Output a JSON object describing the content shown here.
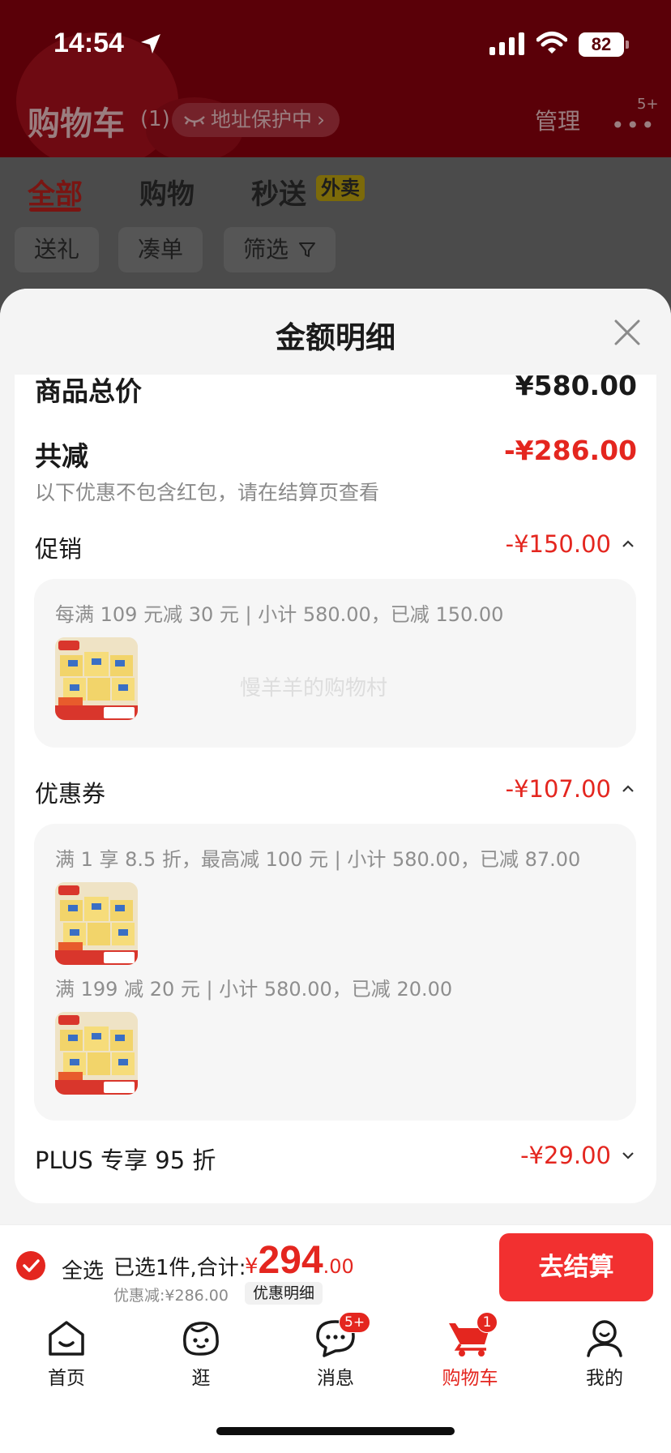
{
  "status_bar": {
    "time": "14:54",
    "battery": "82"
  },
  "cart_header": {
    "title": "购物车",
    "count": "(1)",
    "address_protect": "地址保护中",
    "manage": "管理",
    "more_badge": "5+"
  },
  "tabs": [
    {
      "label": "全部"
    },
    {
      "label": "购物"
    },
    {
      "label": "秒送",
      "tag": "外卖"
    }
  ],
  "filters": [
    {
      "label": "送礼"
    },
    {
      "label": "凑单"
    },
    {
      "label": "筛选"
    }
  ],
  "sheet": {
    "title": "金额明细",
    "total_price": {
      "label": "商品总价",
      "amount": "¥580.00"
    },
    "total_discount": {
      "label": "共减",
      "amount": "-¥286.00",
      "note": "以下优惠不包含红包，请在结算页查看"
    },
    "promotion": {
      "label": "促销",
      "amount": "-¥150.00",
      "rules": [
        {
          "text": "每满 109 元减 30 元 | 小计 580.00，已减 150.00"
        }
      ]
    },
    "coupon": {
      "label": "优惠券",
      "amount": "-¥107.00",
      "rules": [
        {
          "text": "满 1 享 8.5 折，最高减 100 元 | 小计 580.00，已减 87.00"
        },
        {
          "text": "满 199 减 20 元 | 小计 580.00，已减 20.00"
        }
      ]
    },
    "plus": {
      "label": "PLUS 专享 95 折",
      "amount": "-¥29.00"
    },
    "product_thumb": {
      "brand": "心相印",
      "promo": "每满109减30"
    },
    "watermark": "慢羊羊的购物村"
  },
  "checkout": {
    "select_all": "全选",
    "selected_info": "已选1件,合计:",
    "currency": "¥",
    "total_int": "294",
    "total_dec": ".00",
    "discount_line": "优惠减:¥286.00",
    "detail_link": "优惠明细",
    "button": "去结算"
  },
  "tabbar": [
    {
      "label": "首页",
      "icon": "home-icon"
    },
    {
      "label": "逛",
      "icon": "browse-face-icon"
    },
    {
      "label": "消息",
      "icon": "message-icon",
      "badge": "5+"
    },
    {
      "label": "购物车",
      "icon": "cart-icon",
      "badge": "1"
    },
    {
      "label": "我的",
      "icon": "profile-icon"
    }
  ],
  "colors": {
    "accent_red": "#e4261f",
    "checkout_red": "#f23030",
    "header_dim": "#5a0008"
  }
}
